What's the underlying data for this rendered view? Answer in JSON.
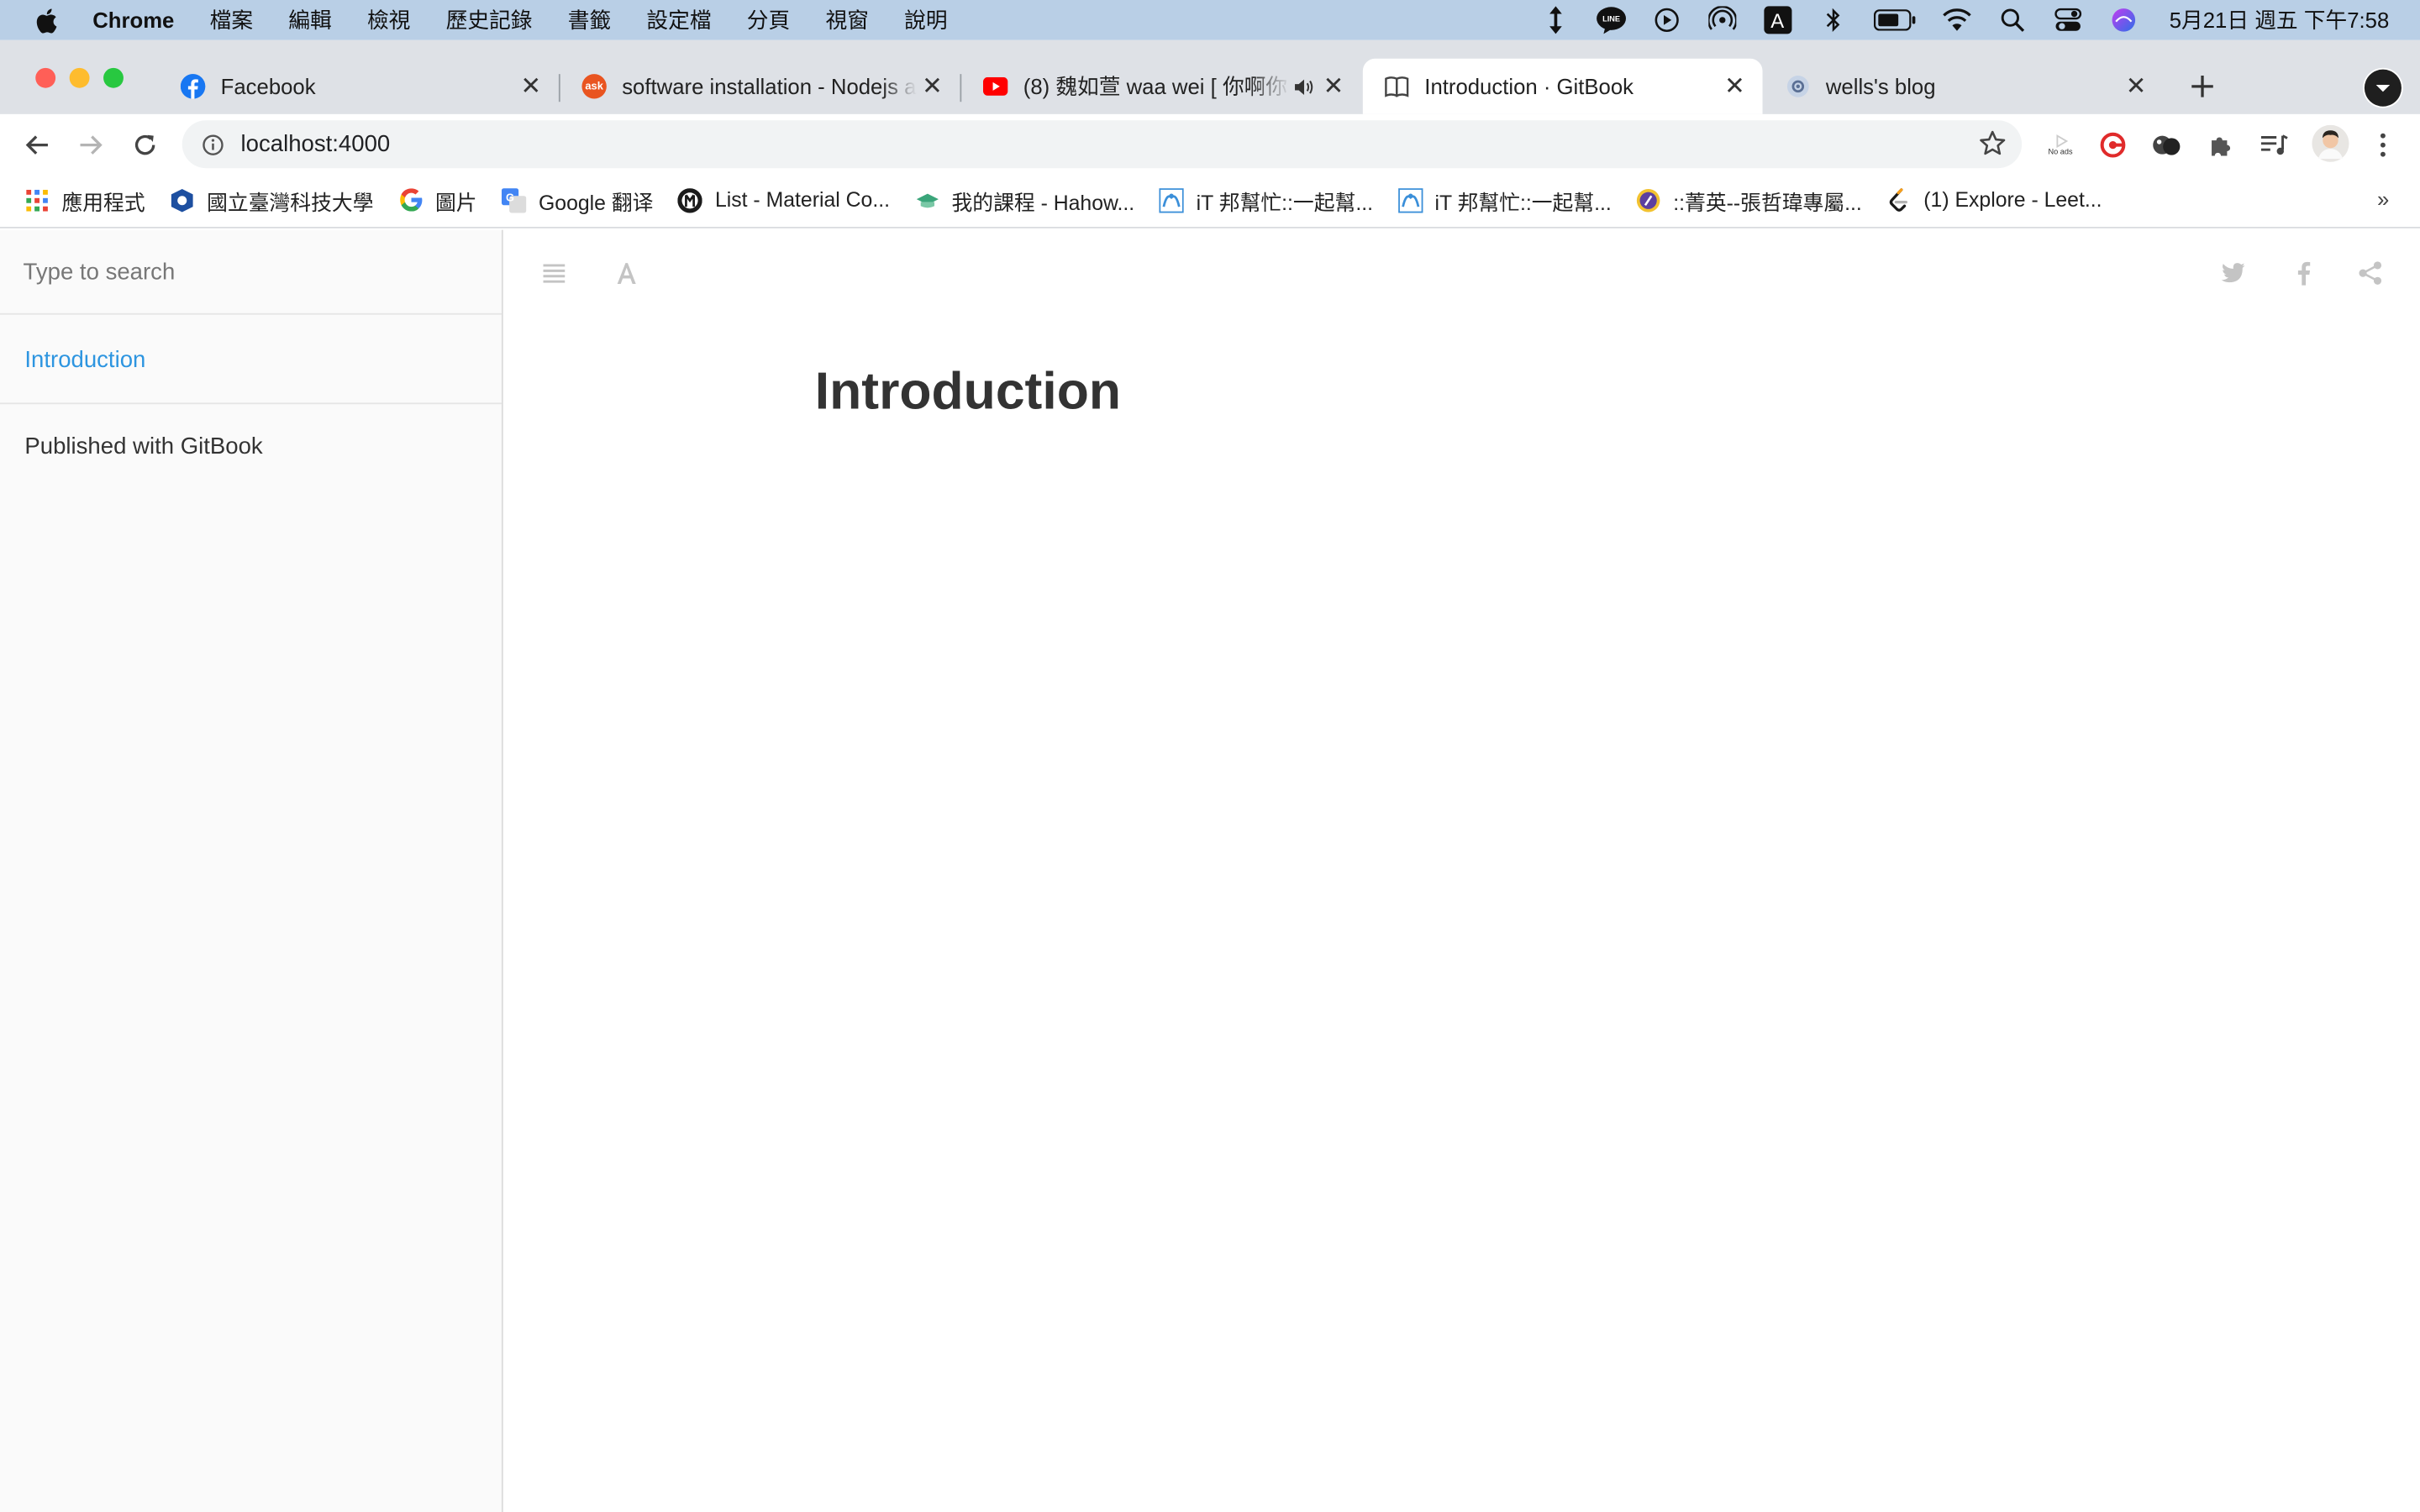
{
  "menubar": {
    "app_name": "Chrome",
    "items": [
      "檔案",
      "編輯",
      "檢視",
      "歷史記錄",
      "書籤",
      "設定檔",
      "分頁",
      "視窗",
      "說明"
    ],
    "clock": "5月21日 週五 下午7:58",
    "status_icons": [
      "resize-icon",
      "line-icon",
      "play-icon",
      "airdrop-icon",
      "input-method-icon",
      "bluetooth-icon",
      "battery-icon",
      "wifi-icon",
      "spotlight-icon",
      "control-center-icon",
      "siri-icon"
    ],
    "input_method_label": "A"
  },
  "tabs": [
    {
      "title": "Facebook",
      "favicon": "facebook",
      "active": false
    },
    {
      "title": "software installation - Nodejs a",
      "favicon": "ask",
      "active": false
    },
    {
      "title": "(8) 魏如萱 waa wei [ 你啊你",
      "favicon": "youtube",
      "active": false,
      "audio": true
    },
    {
      "title": "Introduction · GitBook",
      "favicon": "book",
      "active": true
    },
    {
      "title": "wells's blog",
      "favicon": "globe",
      "active": false
    }
  ],
  "ask_favicon_text": "ask",
  "omnibox": {
    "url": "localhost:4000"
  },
  "extensions": {
    "noads_label": "No ads"
  },
  "bookmarks": [
    {
      "label": "應用程式",
      "icon": "apps-grid-icon"
    },
    {
      "label": "國立臺灣科技大學",
      "icon": "ntust-icon"
    },
    {
      "label": "圖片",
      "icon": "google-icon"
    },
    {
      "label": "Google 翻译",
      "icon": "google-translate-icon"
    },
    {
      "label": "List - Material Co...",
      "icon": "github-icon"
    },
    {
      "label": "我的課程 - Hahow...",
      "icon": "hahow-icon"
    },
    {
      "label": "iT 邦幫忙::一起幫...",
      "icon": "ithome-icon"
    },
    {
      "label": "iT 邦幫忙::一起幫...",
      "icon": "ithome-icon"
    },
    {
      "label": "::菁英--張哲瑋專屬...",
      "icon": "elite-icon"
    },
    {
      "label": "(1) Explore - Leet...",
      "icon": "leetcode-icon"
    }
  ],
  "bookmarks_more": "»",
  "gitbook": {
    "search_placeholder": "Type to search",
    "summary": [
      {
        "label": "Introduction",
        "active": true
      }
    ],
    "published_label": "Published with GitBook",
    "page_title": "Introduction"
  },
  "colors": {
    "menubar_bg": "#b9cfe6",
    "tabstrip_bg": "#dee1e6",
    "link_active": "#2d95e0",
    "sidebar_bg": "#fafafa"
  }
}
